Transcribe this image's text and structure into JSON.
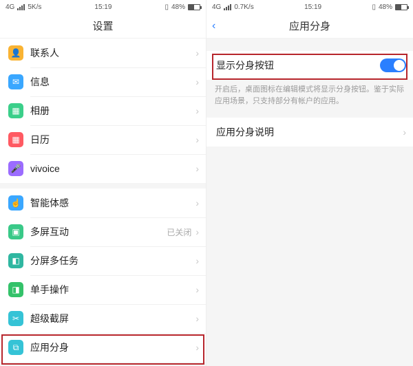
{
  "statusbar": {
    "left_net": "4G",
    "left_speed1": "5K/s",
    "left_speed2": "0.7K/s",
    "time": "15:19",
    "batt_pct": "48%",
    "vib": "▯"
  },
  "left": {
    "title": "设置",
    "rows": {
      "contacts": "联系人",
      "messages": "信息",
      "photos": "相册",
      "calendar": "日历",
      "vivoice": "vivoice",
      "smartSense": "智能体感",
      "multiScreen": "多屏互动",
      "multiScreenAux": "已关闭",
      "splitTask": "分屏多任务",
      "oneHand": "单手操作",
      "superShot": "超级截屏",
      "appClone": "应用分身"
    }
  },
  "right": {
    "title": "应用分身",
    "toggleLabel": "显示分身按钮",
    "desc": "开启后，桌面图标在编辑模式将显示分身按钮。鉴于实际应用场景，只支持部分有帐户的应用。",
    "helpLabel": "应用分身说明"
  }
}
